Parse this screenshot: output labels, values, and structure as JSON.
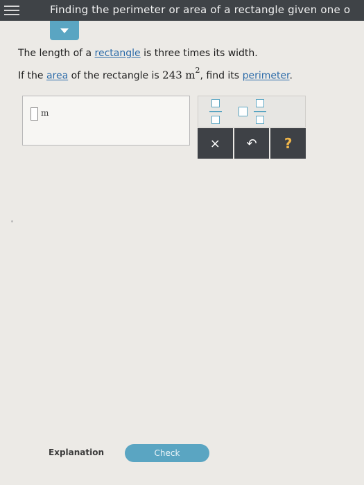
{
  "header": {
    "title": "Finding the perimeter or area of a rectangle given one o"
  },
  "problem": {
    "line1_pre": "The length of a ",
    "line1_link": "rectangle",
    "line1_post": " is three times its width.",
    "line2_pre": "If the ",
    "line2_link_area": "area",
    "line2_mid": " of the rectangle is ",
    "area_value": "243",
    "area_unit": "m",
    "area_exponent": "2",
    "line2_post": ", find its ",
    "line2_link_perimeter": "perimeter",
    "line2_end": "."
  },
  "answer": {
    "unit": "m"
  },
  "keypad": {
    "clear": "×",
    "undo": "↶",
    "help": "?"
  },
  "footer": {
    "explanation": "Explanation",
    "check": "Check"
  }
}
